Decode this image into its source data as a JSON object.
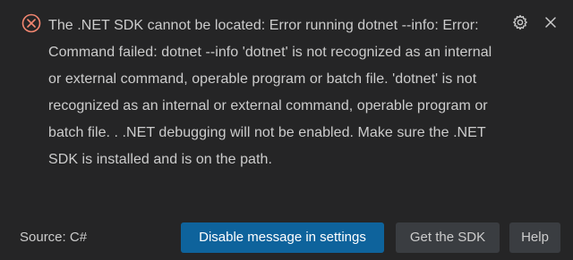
{
  "notification": {
    "severity": "error",
    "icon": "error-circle-icon",
    "message": "The .NET SDK cannot be located: Error running dotnet --info: Error: Command failed: dotnet --info 'dotnet' is not recognized as an internal or external command, operable program or batch file. 'dotnet' is not recognized as an internal or external command, operable program or batch file. . .NET debugging will not be enabled. Make sure the .NET SDK is installed and is on the path.",
    "source": "Source: C#",
    "colors": {
      "error": "#f48771",
      "primary_button": "#0e639c",
      "secondary_button": "#3a3d41",
      "background": "#252526"
    }
  },
  "actions": {
    "settings_icon": "gear-icon",
    "close_icon": "close-icon",
    "disable_label": "Disable message in settings",
    "get_sdk_label": "Get the SDK",
    "help_label": "Help"
  }
}
